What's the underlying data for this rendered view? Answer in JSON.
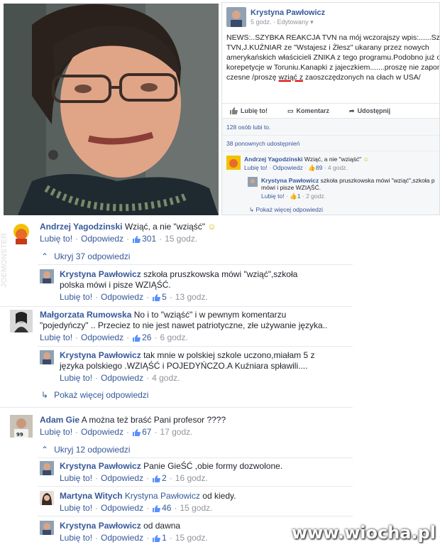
{
  "post": {
    "author": "Krystyna Pawłowicz",
    "time": "5 godz.",
    "edited": "Edytowany",
    "text_lines": [
      "NEWS:..SZYBKA REAKCJA TVN na mój wczorajszy wpis:......Szc",
      "TVN,J.KUŹNIAR ze \"Wstajesz i Żłesz\" ukarany przez nowych",
      "amerykańskich właścicieli ZNIKA z tego programu.Podobno już o",
      "korepetycje w Toruniu.Kanapki z jajeczkiem.......proszę nie zapon"
    ],
    "text_line5_a": "czesne /proszę ",
    "text_line5_u": "wziąć z",
    "text_line5_b": " zaoszczędzonych na cłach w USA/",
    "actions": {
      "like": "Lubię to!",
      "comment": "Komentarz",
      "share": "Udostępnij"
    },
    "likes_count": "128 osób lubi to.",
    "shares_count": "38 ponownych udostępnień",
    "mini": {
      "c1_author": "Andrzej Yagodzinski",
      "c1_text": "Wziąć, a nie \"wziąść\"",
      "c1_like": "Lubię to!",
      "c1_reply": "Odpowiedz",
      "c1_count": "89",
      "c1_time": "4 godz.",
      "c2_author": "Krystyna Pawłowicz",
      "c2_text_1": "szkoła pruszkowska mówi \"wziąć\",szkoła p",
      "c2_text_2": "mówi i pisze WZIĄŚĆ.",
      "c2_like": "Lubię to!",
      "c2_count": "1",
      "c2_time": "2 godz.",
      "more": "Pokaż więcej odpowiedzi"
    }
  },
  "thread": {
    "c1": {
      "author": "Andrzej Yagodzinski",
      "text": "Wziąć, a nie \"wziąść\"",
      "like": "Lubię to!",
      "reply": "Odpowiedz",
      "count": "301",
      "time": "15 godz."
    },
    "toggle1": "Ukryj 37 odpowiedzi",
    "r1": {
      "author": "Krystyna Pawłowicz",
      "text_1": "szkoła pruszkowska mówi \"wziąć\",szkoła",
      "text_2": "polska mówi i pisze WZIĄŚĆ.",
      "like": "Lubię to!",
      "reply": "Odpowiedz",
      "count": "5",
      "time": "13 godz."
    },
    "c2": {
      "author": "Małgorzata Rumowska",
      "text_1": "No i to \"wziąść\" i w pewnym komentarzu",
      "text_2": "\"pojedyńczy\" .. Przeciez to nie jest nawet patriotyczne, złe używanie języka..",
      "like": "Lubię to!",
      "reply": "Odpowiedz",
      "count": "26",
      "time": "6 godz."
    },
    "r2": {
      "author": "Krystyna Pawłowicz",
      "text_1": "tak mnie w polskiej szkole uczono,miałam 5 z",
      "text_2": "języka polskiego .WZIĄŚĆ i POJEDYŃCZO.A Kuźniara spławili....",
      "like": "Lubię to!",
      "reply": "Odpowiedz",
      "time": "4 godz."
    },
    "more": "Pokaż więcej odpowiedzi",
    "c3": {
      "author": "Adam Gie",
      "text": "A można też braść Pani profesor ????",
      "like": "Lubię to!",
      "reply": "Odpowiedz",
      "count": "67",
      "time": "17 godz."
    },
    "toggle2": "Ukryj 12 odpowiedzi",
    "r3": {
      "author": "Krystyna Pawłowicz",
      "text": "Panie GieŚĆ ,obie formy dozwolone.",
      "like": "Lubię to!",
      "reply": "Odpowiedz",
      "count": "2",
      "time": "16 godz."
    },
    "r4": {
      "author": "Martyna Witych",
      "mention": "Krystyna Pawłowicz",
      "text": "od kiedy.",
      "like": "Lubię to!",
      "reply": "Odpowiedz",
      "count": "46",
      "time": "15 godz."
    },
    "r5": {
      "author": "Krystyna Pawłowicz",
      "text": "od dawna",
      "like": "Lubię to!",
      "reply": "Odpowiedz",
      "count": "1",
      "time": "15 godz."
    }
  },
  "watermark": "www.wiocha.pl",
  "side_watermark": "JOEMONSTER"
}
